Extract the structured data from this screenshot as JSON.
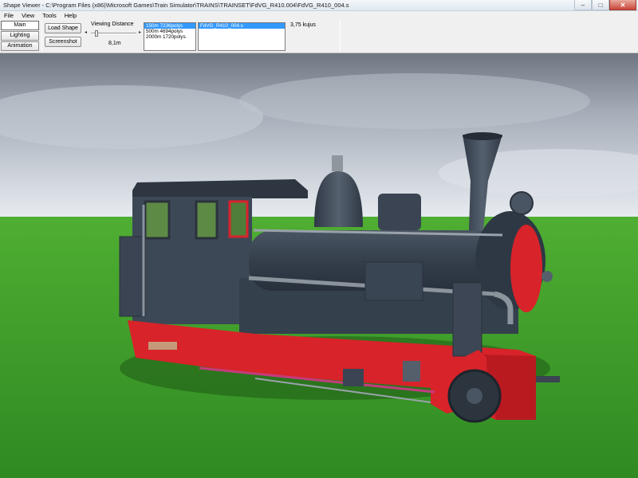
{
  "window": {
    "title": "Shape Viewer - C:\\Program Files (x86)\\Microsoft Games\\Train Simulator\\TRAINS\\TRAINSET\\FdVG_R410.004\\FdVG_R410_004.s",
    "minimize": "–",
    "maximize": "□",
    "close": "✕"
  },
  "menu": [
    "File",
    "View",
    "Tools",
    "Help"
  ],
  "side_tabs": [
    "Main",
    "Lighting",
    "Animation"
  ],
  "toolbar": {
    "load_shape": "Load Shape",
    "screenshot": "Screenshot",
    "viewing_distance_label": "Viewing Distance",
    "viewing_distance_value": "8,1m",
    "slider_left": "◂",
    "slider_right": "▸"
  },
  "lod_list": [
    "150m 7236polys",
    "500m 4694polys",
    "2000m 1720polys"
  ],
  "shape_list": [
    "FdVG_R410_004.s"
  ],
  "status": "3,75 kujus",
  "colors": {
    "sky_top": "#6e7682",
    "sky_bottom": "#e9edf2",
    "grass": "#3f9a2b",
    "loco_body": "#3a4452",
    "loco_red": "#d8232a",
    "selection": "#3399ff"
  }
}
